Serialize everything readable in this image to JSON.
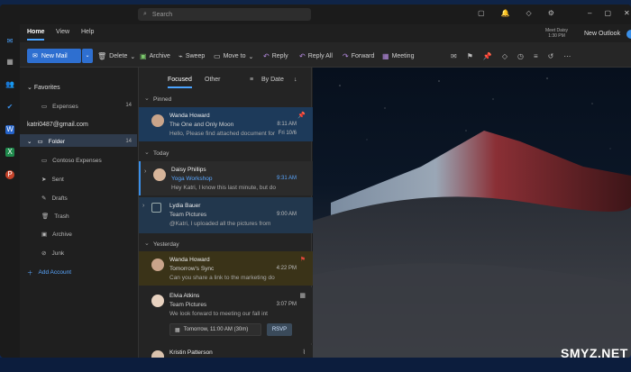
{
  "search": {
    "placeholder": "Search"
  },
  "menu": {
    "tabs": [
      "Home",
      "View",
      "Help"
    ],
    "meet_line1": "Meet Daisy",
    "meet_line2": "1:30 PM",
    "new_outlook_label": "New Outlook"
  },
  "ribbon": {
    "new_mail": "New Mail",
    "delete": "Delete",
    "archive": "Archive",
    "sweep": "Sweep",
    "move_to": "Move to",
    "reply": "Reply",
    "reply_all": "Reply All",
    "forward": "Forward",
    "meeting": "Meeting"
  },
  "folders": {
    "favorites": "Favorites",
    "expenses": "Expenses",
    "expenses_count": "14",
    "account": "katri0487@gmail.com",
    "folder": "Folder",
    "folder_count": "14",
    "items": [
      "Contoso Expenses",
      "Sent",
      "Drafts",
      "Trash",
      "Archive",
      "Junk"
    ],
    "add_account": "Add Account"
  },
  "list": {
    "tab_focused": "Focused",
    "tab_other": "Other",
    "sort": "By Date",
    "sections": {
      "pinned": "Pinned",
      "today": "Today",
      "yesterday": "Yesterday"
    },
    "messages": [
      {
        "name": "Wanda Howard",
        "subject": "The One and Only Moon",
        "preview": "Hello, Please find attached document for",
        "time": "8:11 AM",
        "date": "Fri 10/6"
      },
      {
        "name": "Daisy Phillips",
        "subject": "Yoga Workshop",
        "preview": "Hey Katri, I know this last minute, but do",
        "time": "9:31 AM"
      },
      {
        "name": "Lydia Bauer",
        "subject": "Team Pictures",
        "preview": "@Katri, I uploaded all the pictures from",
        "time": "9:00 AM"
      },
      {
        "name": "Wanda Howard",
        "subject": "Tomorrow's Sync",
        "preview": "Can you share a link to the marketing do",
        "time": "4:22 PM"
      },
      {
        "name": "Elvia Atkins",
        "subject": "Team Pictures",
        "preview": "We look forward to meeting our fall int",
        "time": "3:07 PM",
        "event": "Tomorrow, 11:00 AM (30m)",
        "rsvp": "RSVP"
      },
      {
        "name": "Kristin Patterson",
        "subject": "",
        "preview": "",
        "time": ""
      }
    ]
  },
  "watermark": "SMYZ.NET",
  "colors": {
    "accent": "#2e6fd0",
    "selected": "#2f3b4c",
    "highlight": "#22374d",
    "pinned_bg": "#1d3a5a",
    "yesterday_bg": "#3a3318"
  }
}
